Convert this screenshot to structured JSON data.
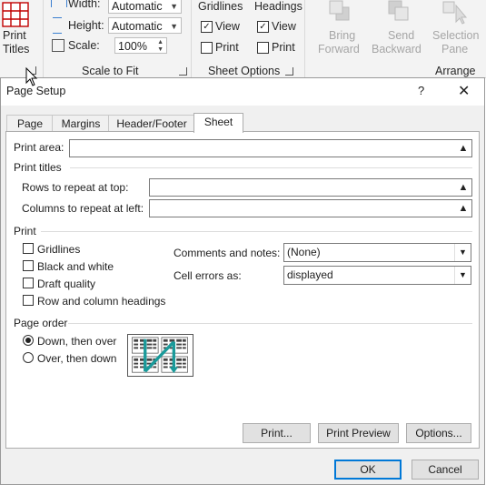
{
  "ribbon": {
    "print_titles": {
      "line1": "Print",
      "line2": "Titles"
    },
    "scale_to_fit": {
      "width_label": "Width:",
      "width_value": "Automatic",
      "height_label": "Height:",
      "height_value": "Automatic",
      "scale_label": "Scale:",
      "scale_value": "100%",
      "group_label": "Scale to Fit"
    },
    "sheet_options": {
      "gridlines": "Gridlines",
      "headings": "Headings",
      "view": "View",
      "print": "Print",
      "group_label": "Sheet Options"
    },
    "arrange": {
      "bring_forward": {
        "line1": "Bring",
        "line2": "Forward"
      },
      "send_backward": {
        "line1": "Send",
        "line2": "Backward"
      },
      "selection_pane": {
        "line1": "Selection",
        "line2": "Pane"
      },
      "group_label": "Arrange"
    }
  },
  "dialog": {
    "title": "Page Setup",
    "help": "?",
    "close": "✕",
    "tabs": [
      "Page",
      "Margins",
      "Header/Footer",
      "Sheet"
    ],
    "active_tab": "Sheet",
    "print_area_label": "Print area:",
    "print_area_value": "",
    "print_titles_label": "Print titles",
    "rows_repeat_label": "Rows to repeat at top:",
    "rows_repeat_value": "",
    "cols_repeat_label": "Columns to repeat at left:",
    "cols_repeat_value": "",
    "print_section_label": "Print",
    "checkboxes": {
      "gridlines": "Gridlines",
      "black_white": "Black and white",
      "draft_quality": "Draft quality",
      "row_col_headings": "Row and column headings"
    },
    "comments_label": "Comments and notes:",
    "comments_value": "(None)",
    "cell_errors_label": "Cell errors as:",
    "cell_errors_value": "displayed",
    "page_order_label": "Page order",
    "down_then_over": "Down, then over",
    "over_then_down": "Over, then down",
    "buttons": {
      "print": "Print...",
      "print_preview": "Print Preview",
      "options": "Options...",
      "ok": "OK",
      "cancel": "Cancel"
    }
  },
  "colors": {
    "accent": "#0078d7",
    "arrow": "#1a9a9a"
  }
}
